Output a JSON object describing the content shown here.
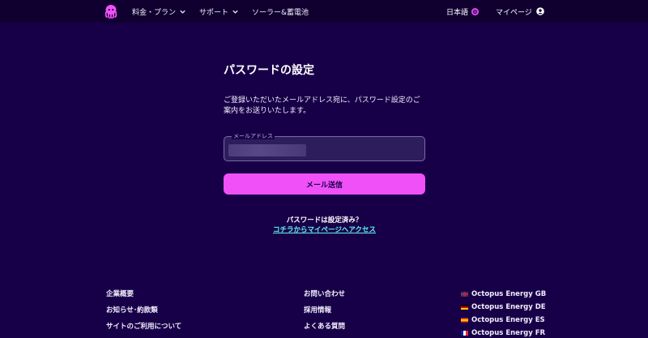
{
  "header": {
    "nav": [
      {
        "label": "料金・プラン",
        "has_dropdown": true
      },
      {
        "label": "サポート",
        "has_dropdown": true
      },
      {
        "label": "ソーラー&蓄電池",
        "has_dropdown": false
      }
    ],
    "language_label": "日本語",
    "mypage_label": "マイページ"
  },
  "main": {
    "title": "パスワードの設定",
    "description": "ご登録いただいたメールアドレス宛に、パスワード設定のご案内をお送りいたします。",
    "email_field": {
      "label": "メールアドレス",
      "value": ""
    },
    "submit_label": "メール送信",
    "question": "パスワードは設定済み？",
    "access_link": "コチラからマイページへアクセス"
  },
  "footer": {
    "col1": [
      "企業概要",
      "お知らせ･約款類",
      "サイトのご利用について"
    ],
    "col2": [
      "お問い合わせ",
      "採用情報",
      "よくある質問"
    ],
    "countries": [
      {
        "label": "Octopus Energy GB",
        "flag": "gb"
      },
      {
        "label": "Octopus Energy DE",
        "flag": "de"
      },
      {
        "label": "Octopus Energy ES",
        "flag": "es"
      },
      {
        "label": "Octopus Energy FR",
        "flag": "fr"
      }
    ]
  },
  "colors": {
    "background": "#180048",
    "header": "#100030",
    "accent_pink": "#f050f8",
    "link_cyan": "#60f0f8"
  }
}
